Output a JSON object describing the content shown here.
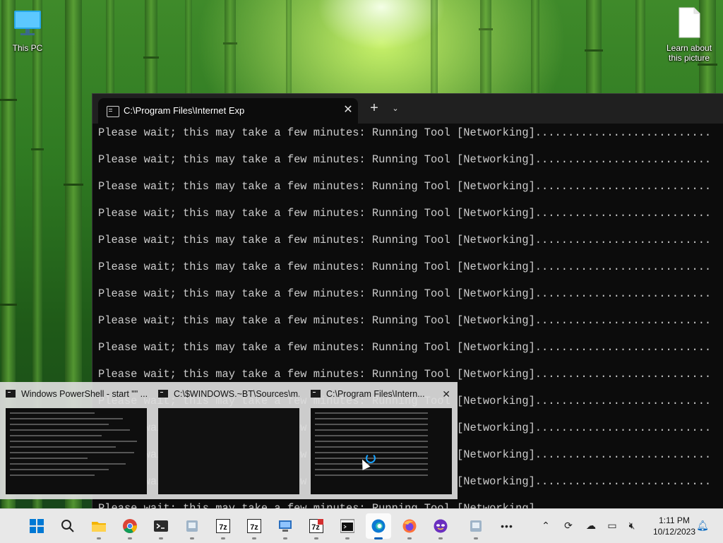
{
  "desktop": {
    "icons": [
      {
        "label": "This PC",
        "icon": "monitor-icon"
      },
      {
        "label": "Learn about this picture",
        "icon": "document-icon"
      }
    ]
  },
  "terminal": {
    "tab_title": "C:\\Program Files\\Internet Exp",
    "new_tab_label": "+",
    "close_tab_label": "✕",
    "dropdown_label": "⌄",
    "line_text": "Please wait; this may take a few minutes: Running Tool [Networking]...........................",
    "lines_visible": 15,
    "last_line_partial": "Please wait; this may take a few minutes: Running Tool [Networking]..........................."
  },
  "task_switcher": {
    "windows": [
      {
        "title": "Windows PowerShell - start  \"\" ..."
      },
      {
        "title": "C:\\$WINDOWS.~BT\\Sources\\m..."
      },
      {
        "title": "C:\\Program Files\\Intern..."
      }
    ]
  },
  "taskbar": {
    "apps": [
      {
        "name": "start-icon"
      },
      {
        "name": "search-icon"
      },
      {
        "name": "file-explorer-icon"
      },
      {
        "name": "chrome-icon"
      },
      {
        "name": "terminal-icon"
      },
      {
        "name": "app-icon"
      },
      {
        "name": "7zip-icon",
        "text": "7z"
      },
      {
        "name": "7zip-icon",
        "text": "7z"
      },
      {
        "name": "computer-icon"
      },
      {
        "name": "7zip-icon",
        "text": "7z"
      },
      {
        "name": "console-icon"
      },
      {
        "name": "edge-icon"
      },
      {
        "name": "firefox-icon"
      },
      {
        "name": "mask-icon"
      },
      {
        "name": "app-icon"
      },
      {
        "name": "more-icon",
        "text": "•••"
      }
    ],
    "tray": {
      "time": "1:11 PM",
      "date": "10/12/2023"
    }
  }
}
